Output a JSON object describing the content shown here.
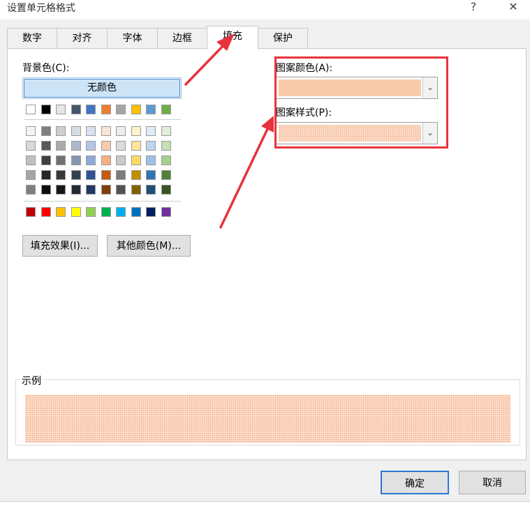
{
  "window": {
    "title": "设置单元格格式",
    "help": "?",
    "close": "✕"
  },
  "tabs": [
    {
      "label": "数字"
    },
    {
      "label": "对齐"
    },
    {
      "label": "字体"
    },
    {
      "label": "边框"
    },
    {
      "label": "填充",
      "active": true
    },
    {
      "label": "保护"
    }
  ],
  "fill": {
    "background_label": "背景色(C):",
    "no_color": "无颜色",
    "theme_top_row": [
      "#ffffff",
      "#000000",
      "#e7e6e6",
      "#44546a",
      "#4472c4",
      "#ed7d31",
      "#a5a5a5",
      "#ffc000",
      "#5b9bd5",
      "#70ad47"
    ],
    "theme_shades": [
      [
        "#f2f2f2",
        "#7f7f7f",
        "#d0cece",
        "#d6dce4",
        "#d9e2f3",
        "#fbe5d5",
        "#ededed",
        "#fff2cc",
        "#deebf6",
        "#e2efd9"
      ],
      [
        "#d8d8d8",
        "#595959",
        "#aeabab",
        "#adb9ca",
        "#b4c6e7",
        "#f7cbac",
        "#dbdbdb",
        "#fee599",
        "#bdd7ee",
        "#c5e0b3"
      ],
      [
        "#bfbfbf",
        "#3f3f3f",
        "#757070",
        "#8496b0",
        "#8eaadb",
        "#f4b183",
        "#c9c9c9",
        "#ffd965",
        "#9cc3e5",
        "#a8d08d"
      ],
      [
        "#a5a5a5",
        "#262626",
        "#3a3838",
        "#323f4f",
        "#2f5496",
        "#c55a11",
        "#7b7b7b",
        "#bf9000",
        "#2e75b5",
        "#538135"
      ],
      [
        "#7f7f7f",
        "#0c0c0c",
        "#171616",
        "#222a35",
        "#1f3864",
        "#833c0b",
        "#525252",
        "#7f6000",
        "#1e4e79",
        "#375623"
      ]
    ],
    "standard": [
      "#c00000",
      "#ff0000",
      "#ffc000",
      "#ffff00",
      "#92d050",
      "#00b050",
      "#00b0f0",
      "#0070c0",
      "#002060",
      "#7030a0"
    ],
    "effects_button": "填充效果(I)...",
    "more_colors_button": "其他颜色(M)...",
    "pattern_color_label": "图案颜色(A):",
    "pattern_color_value": "#f8cbad",
    "pattern_style_label": "图案样式(P):",
    "sample_label": "示例"
  },
  "footer": {
    "ok": "确定",
    "cancel": "取消"
  },
  "annotations": {
    "arrow_color": "#e8333c"
  }
}
